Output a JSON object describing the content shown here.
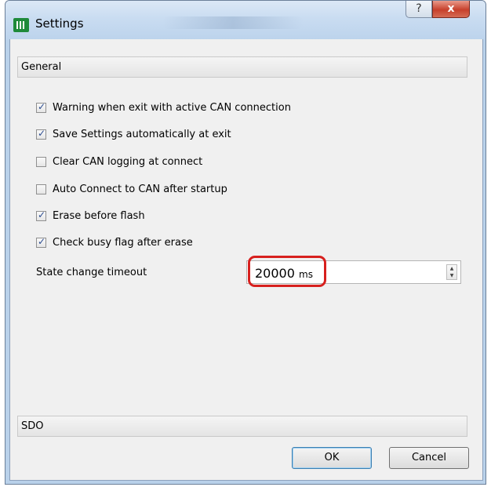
{
  "window": {
    "title": "Settings",
    "help_label": "?",
    "close_label": "x"
  },
  "sections": {
    "general": "General",
    "sdo": "SDO"
  },
  "options": [
    {
      "label": "Warning when exit with active CAN connection",
      "checked": true
    },
    {
      "label": "Save Settings automatically at exit",
      "checked": true
    },
    {
      "label": "Clear CAN logging at connect",
      "checked": false
    },
    {
      "label": "Auto Connect to CAN after startup",
      "checked": false
    },
    {
      "label": "Erase before flash",
      "checked": true
    },
    {
      "label": "Check busy flag after erase",
      "checked": true
    }
  ],
  "timeout": {
    "label": "State change timeout",
    "value": "20000",
    "unit": "ms"
  },
  "buttons": {
    "ok": "OK",
    "cancel": "Cancel"
  },
  "colors": {
    "highlight": "#d7201e",
    "checkmark": "#2c4c90"
  }
}
